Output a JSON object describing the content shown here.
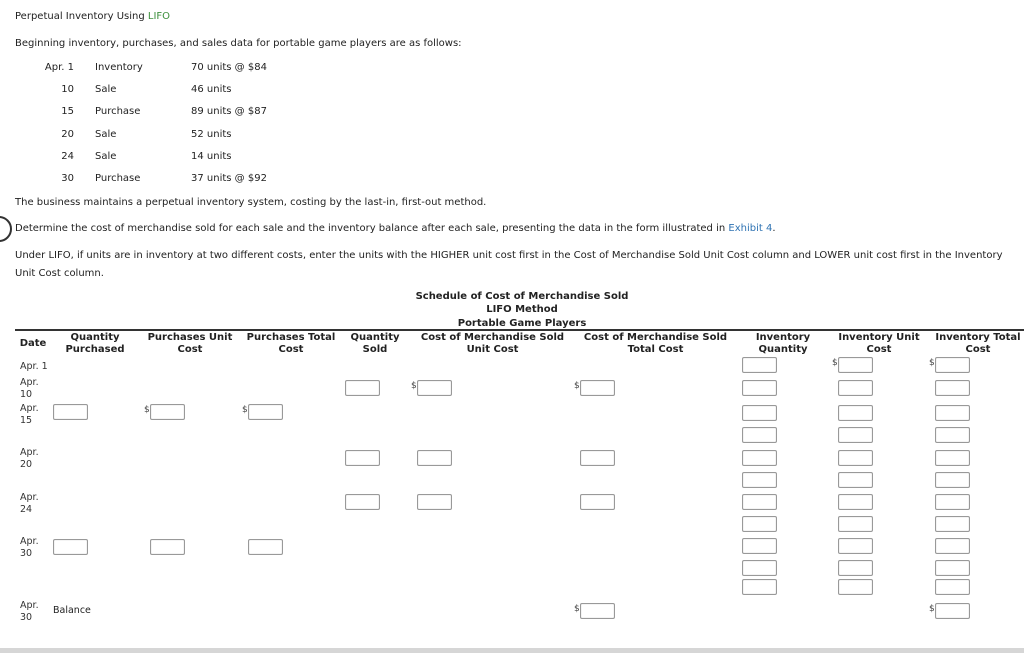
{
  "title": {
    "prefix": "Perpetual Inventory Using ",
    "link": "LIFO"
  },
  "intro": "Beginning inventory, purchases, and sales data for portable game players are as follows:",
  "events": [
    {
      "date": "Apr. 1",
      "type": "Inventory",
      "detail": "70 units @ $84"
    },
    {
      "date": "10",
      "type": "Sale",
      "detail": "46 units"
    },
    {
      "date": "15",
      "type": "Purchase",
      "detail": "89 units @ $87"
    },
    {
      "date": "20",
      "type": "Sale",
      "detail": "52 units"
    },
    {
      "date": "24",
      "type": "Sale",
      "detail": "14 units"
    },
    {
      "date": "30",
      "type": "Purchase",
      "detail": "37 units @ $92"
    }
  ],
  "method_note": "The business maintains a perpetual inventory system, costing by the last-in, first-out method.",
  "instruction": {
    "text": "Determine the cost of merchandise sold for each sale and the inventory balance after each sale, presenting the data in the form illustrated in ",
    "link": "Exhibit 4",
    "suffix": "."
  },
  "lifo_note_line1": "Under LIFO, if units are in inventory at two different costs, enter the units with the HIGHER unit cost first in the Cost of Merchandise Sold Unit Cost column and LOWER unit cost first in the Inventory",
  "lifo_note_line2": "Unit Cost column.",
  "schedule": {
    "title1": "Schedule of Cost of Merchandise Sold",
    "title2": "LIFO Method",
    "title3": "Portable Game Players",
    "columns": {
      "date": "Date",
      "qty_purchased": [
        "Quantity",
        "Purchased"
      ],
      "purch_unit_cost": [
        "Purchases Unit",
        "Cost"
      ],
      "purch_total_cost": [
        "Purchases Total",
        "Cost"
      ],
      "qty_sold": [
        "Quantity",
        "Sold"
      ],
      "cogs_unit_cost": [
        "Cost of Merchandise Sold",
        "Unit Cost"
      ],
      "cogs_total_cost": [
        "Cost of Merchandise Sold",
        "Total Cost"
      ],
      "inv_qty": [
        "Inventory",
        "Quantity"
      ],
      "inv_unit_cost": [
        "Inventory Unit",
        "Cost"
      ],
      "inv_total_cost": [
        "Inventory Total",
        "Cost"
      ]
    },
    "rows": [
      {
        "date1": "Apr. 1",
        "date2": ""
      },
      {
        "date1": "Apr.",
        "date2": "10"
      },
      {
        "date1": "Apr.",
        "date2": "15"
      },
      {
        "date1": "Apr.",
        "date2": "20"
      },
      {
        "date1": "Apr.",
        "date2": "24"
      },
      {
        "date1": "Apr.",
        "date2": "30"
      },
      {
        "date1": "Apr.",
        "date2": "30",
        "label": "Balance"
      }
    ],
    "currency_symbol": "$"
  }
}
